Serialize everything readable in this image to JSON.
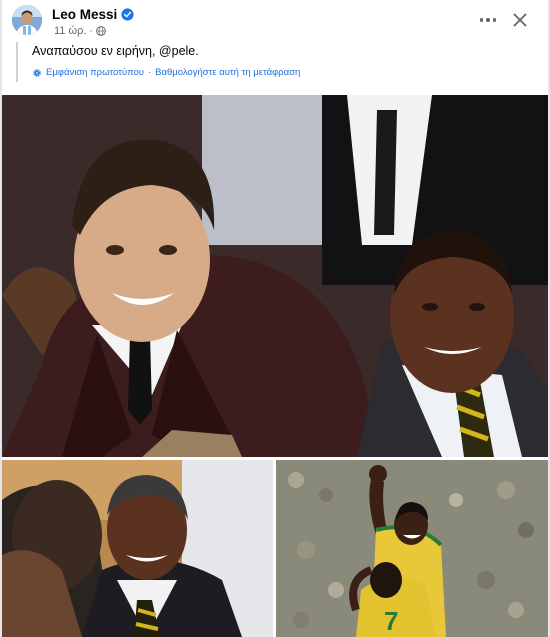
{
  "post": {
    "author": "Leo Messi",
    "timestamp": "11 ώρ.",
    "text": "Αναπαύσου εν ειρήνη, @pele.",
    "translation": {
      "show_original": "Εμφάνιση πρωτοτύπου",
      "separator": "·",
      "rate_translation": "Βαθμολογήστε αυτή τη μετάφραση"
    }
  },
  "icons": {
    "verified": "verified-badge-icon",
    "audience": "globe-icon",
    "translation": "gear-icon",
    "more": "more-options-icon",
    "close": "close-icon"
  },
  "colors": {
    "link": "#216fdb",
    "verified": "#1877f2",
    "secondary_text": "#65676b"
  },
  "photos": [
    {
      "description": "Messi and Pelé smiling at an awards gala"
    },
    {
      "description": "Pelé hugging a man"
    },
    {
      "description": "Pelé celebrating in a yellow Brazil jersey"
    }
  ]
}
